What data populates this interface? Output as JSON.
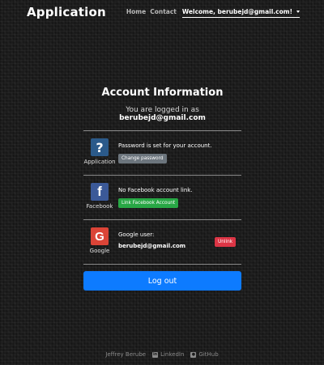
{
  "navbar": {
    "brand": "Application",
    "links": [
      "Home",
      "Contact"
    ],
    "user_label": "Welcome, berubejd@gmail.com!"
  },
  "account": {
    "title": "Account Information",
    "logged_in_prefix": "You are logged in as",
    "email": "berubejd@gmail.com",
    "providers": [
      {
        "name": "Application",
        "icon": "question-mark-icon",
        "color": "#2b5a8a",
        "message": "Password is set for your account.",
        "button": "Change password"
      },
      {
        "name": "Facebook",
        "icon": "facebook-icon",
        "color": "#3b5998",
        "message": "No Facebook account link.",
        "button": "Link Facebook Account"
      },
      {
        "name": "Google",
        "icon": "google-icon",
        "color": "#db4437",
        "message": "Google user:",
        "email": "berubejd@gmail.com",
        "button": "Unlink"
      }
    ],
    "logout_label": "Log out"
  },
  "footer": {
    "author": "Jeffrey Berube",
    "linkedin": "LinkedIn",
    "github": "GitHub"
  },
  "colors": {
    "primary": "#0d7bff",
    "success": "#28a745",
    "danger": "#dc3545",
    "secondary": "#6c757d"
  }
}
